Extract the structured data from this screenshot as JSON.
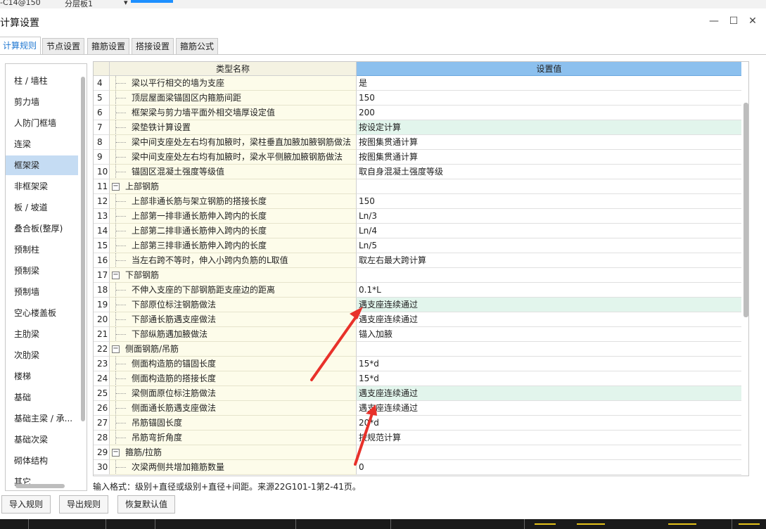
{
  "background": {
    "toolbar_text_1": "-C14@150",
    "toolbar_text_2": "分层板1"
  },
  "window": {
    "title": "计算设置",
    "minimize": "—",
    "maximize": "☐",
    "close": "✕"
  },
  "tabs": [
    {
      "label": "计算规则",
      "active": true
    },
    {
      "label": "节点设置",
      "active": false
    },
    {
      "label": "箍筋设置",
      "active": false
    },
    {
      "label": "搭接设置",
      "active": false
    },
    {
      "label": "箍筋公式",
      "active": false
    }
  ],
  "sidebar": {
    "items": [
      "柱 / 墙柱",
      "剪力墙",
      "人防门框墙",
      "连梁",
      "框架梁",
      "非框架梁",
      "板 / 坡道",
      "叠合板(整厚)",
      "预制柱",
      "预制梁",
      "预制墙",
      "空心楼盖板",
      "主肋梁",
      "次肋梁",
      "楼梯",
      "基础",
      "基础主梁 / 承...",
      "基础次梁",
      "砌体结构",
      "其它"
    ],
    "selected": "框架梁"
  },
  "grid": {
    "col_name": "类型名称",
    "col_value": "设置值",
    "rows": [
      {
        "num": "4",
        "name": "梁以平行相交的墙为支座",
        "value": "是",
        "group": false,
        "hl": false
      },
      {
        "num": "5",
        "name": "顶层屋面梁锚固区内箍筋间距",
        "value": "150",
        "group": false,
        "hl": false
      },
      {
        "num": "6",
        "name": "框架梁与剪力墙平面外相交墙厚设定值",
        "value": "200",
        "group": false,
        "hl": false
      },
      {
        "num": "7",
        "name": "梁垫铁计算设置",
        "value": "按设定计算",
        "group": false,
        "hl": true
      },
      {
        "num": "8",
        "name": "梁中间支座处左右均有加腋时，梁柱垂直加腋加腋钢筋做法",
        "value": "按图集贯通计算",
        "group": false,
        "hl": false
      },
      {
        "num": "9",
        "name": "梁中间支座处左右均有加腋时，梁水平侧腋加腋钢筋做法",
        "value": "按图集贯通计算",
        "group": false,
        "hl": false
      },
      {
        "num": "10",
        "name": "锚固区混凝土强度等级值",
        "value": "取自身混凝土强度等级",
        "group": false,
        "hl": false
      },
      {
        "num": "11",
        "name": "上部钢筋",
        "value": "",
        "group": true,
        "hl": false
      },
      {
        "num": "12",
        "name": "上部非通长筋与架立钢筋的搭接长度",
        "value": "150",
        "group": false,
        "hl": false
      },
      {
        "num": "13",
        "name": "上部第一排非通长筋伸入跨内的长度",
        "value": "Ln/3",
        "group": false,
        "hl": false
      },
      {
        "num": "14",
        "name": "上部第二排非通长筋伸入跨内的长度",
        "value": "Ln/4",
        "group": false,
        "hl": false
      },
      {
        "num": "15",
        "name": "上部第三排非通长筋伸入跨内的长度",
        "value": "Ln/5",
        "group": false,
        "hl": false
      },
      {
        "num": "16",
        "name": "当左右跨不等时，伸入小跨内负筋的L取值",
        "value": "取左右最大跨计算",
        "group": false,
        "hl": false
      },
      {
        "num": "17",
        "name": "下部钢筋",
        "value": "",
        "group": true,
        "hl": false
      },
      {
        "num": "18",
        "name": "不伸入支座的下部钢筋距支座边的距离",
        "value": "0.1*L",
        "group": false,
        "hl": false
      },
      {
        "num": "19",
        "name": "下部原位标注钢筋做法",
        "value": "遇支座连续通过",
        "group": false,
        "hl": true
      },
      {
        "num": "20",
        "name": "下部通长筋遇支座做法",
        "value": "遇支座连续通过",
        "group": false,
        "hl": false
      },
      {
        "num": "21",
        "name": "下部纵筋遇加腋做法",
        "value": "锚入加腋",
        "group": false,
        "hl": false
      },
      {
        "num": "22",
        "name": "侧面钢筋/吊筋",
        "value": "",
        "group": true,
        "hl": false
      },
      {
        "num": "23",
        "name": "侧面构造筋的锚固长度",
        "value": "15*d",
        "group": false,
        "hl": false
      },
      {
        "num": "24",
        "name": "侧面构造筋的搭接长度",
        "value": "15*d",
        "group": false,
        "hl": false
      },
      {
        "num": "25",
        "name": "梁侧面原位标注筋做法",
        "value": "遇支座连续通过",
        "group": false,
        "hl": true
      },
      {
        "num": "26",
        "name": "侧面通长筋遇支座做法",
        "value": "遇支座连续通过",
        "group": false,
        "hl": false
      },
      {
        "num": "27",
        "name": "吊筋锚固长度",
        "value": "20*d",
        "group": false,
        "hl": false
      },
      {
        "num": "28",
        "name": "吊筋弯折角度",
        "value": "按规范计算",
        "group": false,
        "hl": false
      },
      {
        "num": "29",
        "name": "箍筋/拉筋",
        "value": "",
        "group": true,
        "hl": false
      },
      {
        "num": "30",
        "name": "次梁两侧共增加箍筋数量",
        "value": "0",
        "group": false,
        "hl": false
      }
    ]
  },
  "hint": "输入格式：级别+直径或级别+直径+间距。来源22G101-1第2-41页。",
  "buttons": {
    "import": "导入规则",
    "export": "导出规则",
    "reset": "恢复默认值"
  },
  "colors": {
    "tab_active_text": "#1f77d1",
    "header_value_bg": "#8cc0ee",
    "selected_row": "#c5dcf3",
    "highlight_value": "#e2f5ec",
    "annotation_arrow": "#e8312a"
  }
}
